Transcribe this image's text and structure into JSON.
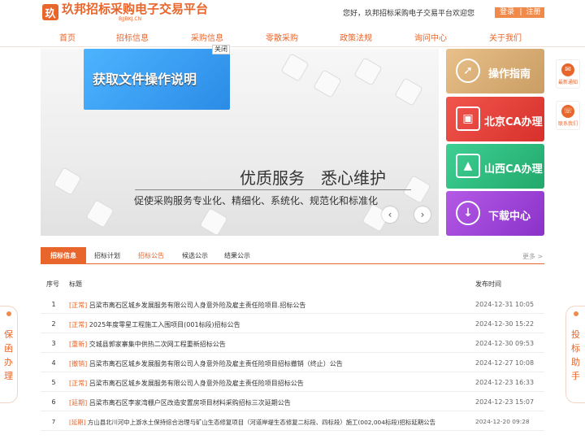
{
  "header": {
    "logo_mark": "玖",
    "logo_title": "玖邦招标采购电子交易平台",
    "logo_sub": "BJJBKJ.CN",
    "welcome": "您好，玖邦招标采购电子交易平台欢迎您",
    "login": "登录",
    "sep": "|",
    "register": "注册"
  },
  "nav": [
    "首页",
    "招标信息",
    "采购信息",
    "零散采购",
    "政策法规",
    "询问中心",
    "关于我们"
  ],
  "hero": {
    "popup": "获取文件操作说明",
    "close": "关闭",
    "title": "优质服务　悉心维护",
    "subtitle": "促使采购服务专业化、精细化、系统化、规范化和标准化",
    "prev": "‹",
    "next": "›",
    "slide_count": 4,
    "active_slide": 2
  },
  "services": [
    "操作指南",
    "北京CA办理",
    "山西CA办理",
    "下载中心"
  ],
  "float_right": [
    "最新通知",
    "联系我们"
  ],
  "side_left": [
    "保",
    "函",
    "办",
    "理"
  ],
  "side_right": [
    "投",
    "标",
    "助",
    "手"
  ],
  "tabs": [
    "招标信息",
    "招标计划",
    "招标公告",
    "候选公示",
    "结果公示"
  ],
  "more": "更多 >",
  "table": {
    "headers": {
      "no": "序号",
      "title": "标题",
      "date": "发布时间"
    },
    "rows": [
      {
        "no": "1",
        "tag": "[正常]",
        "title": "吕梁市离石区城乡发展服务有限公司人身意外险及雇主责任险项目.招标公告",
        "date": "2024-12-31 10:05"
      },
      {
        "no": "2",
        "tag": "[正常]",
        "title": "2025年度零星工程施工入围项目(001标段)招标公告",
        "date": "2024-12-30 15:22"
      },
      {
        "no": "3",
        "tag": "[重新]",
        "title": "交城县郭家寨集中供热二次网工程重新招标公告",
        "date": "2024-12-30 09:53"
      },
      {
        "no": "4",
        "tag": "[撤销]",
        "title": "吕梁市离石区城乡发展服务有限公司人身意外险及雇主责任险项目招标撤销（终止）公告",
        "date": "2024-12-27 10:08"
      },
      {
        "no": "5",
        "tag": "[正常]",
        "title": "吕梁市离石区城乡发展服务有限公司人身意外险及雇主责任险项目招标公告",
        "date": "2024-12-23 16:33"
      },
      {
        "no": "6",
        "tag": "[延期]",
        "title": "吕梁市离石区李家湾棚户区改造安置房项目材料采购招标三次延期公告",
        "date": "2024-12-23 15:07"
      },
      {
        "no": "7",
        "tag": "[延期]",
        "title": "方山县北川河中上游水土保持综合治理与矿山生态修复项目（河道岸堤生态修复二标段、四标段）施工(002,004标段)招标延期公告",
        "date": "2024-12-20 09:28"
      }
    ]
  }
}
